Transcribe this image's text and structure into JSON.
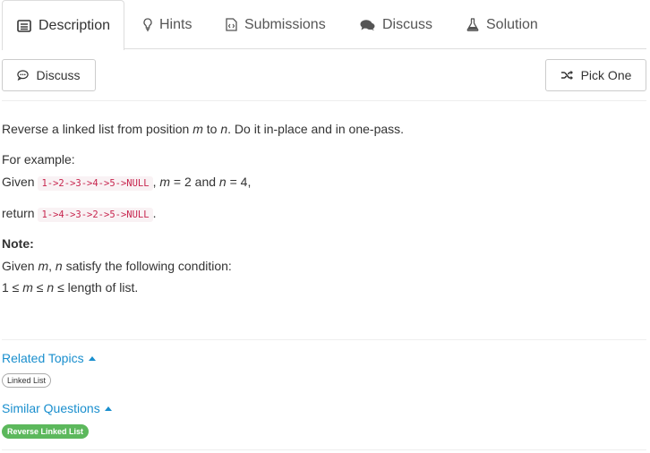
{
  "tabs": [
    {
      "label": "Description",
      "icon": "description-icon",
      "active": true
    },
    {
      "label": "Hints",
      "icon": "lightbulb-icon"
    },
    {
      "label": "Submissions",
      "icon": "code-file-icon"
    },
    {
      "label": "Discuss",
      "icon": "comments-icon"
    },
    {
      "label": "Solution",
      "icon": "flask-icon"
    }
  ],
  "toolbar": {
    "discuss_label": "Discuss",
    "pick_one_label": "Pick One"
  },
  "problem": {
    "intro_a": "Reverse a linked list from position ",
    "m": "m",
    "intro_to": " to ",
    "n": "n",
    "intro_b": ". Do it in-place and in one-pass.",
    "for_example": "For example:",
    "given": "Given ",
    "given_list": "1->2->3->4->5->NULL",
    "given_params_a": ", ",
    "given_params_b": " = 2 and ",
    "given_params_c": " = 4,",
    "return_label": "return ",
    "return_list": "1->4->3->2->5->NULL",
    "return_end": ".",
    "note_label": "Note:",
    "note_a": "Given ",
    "note_b": ", ",
    "note_c": " satisfy the following condition:",
    "cond_a": "1 ≤ ",
    "cond_b": " ≤ ",
    "cond_c": " ≤ length of list."
  },
  "related_topics": {
    "label": "Related Topics",
    "tags": [
      "Linked List"
    ]
  },
  "similar_questions": {
    "label": "Similar Questions",
    "items": [
      "Reverse Linked List"
    ]
  },
  "colors": {
    "link": "#1a8fce",
    "easy_badge": "#5cb85c",
    "code_text": "#c7254e"
  }
}
